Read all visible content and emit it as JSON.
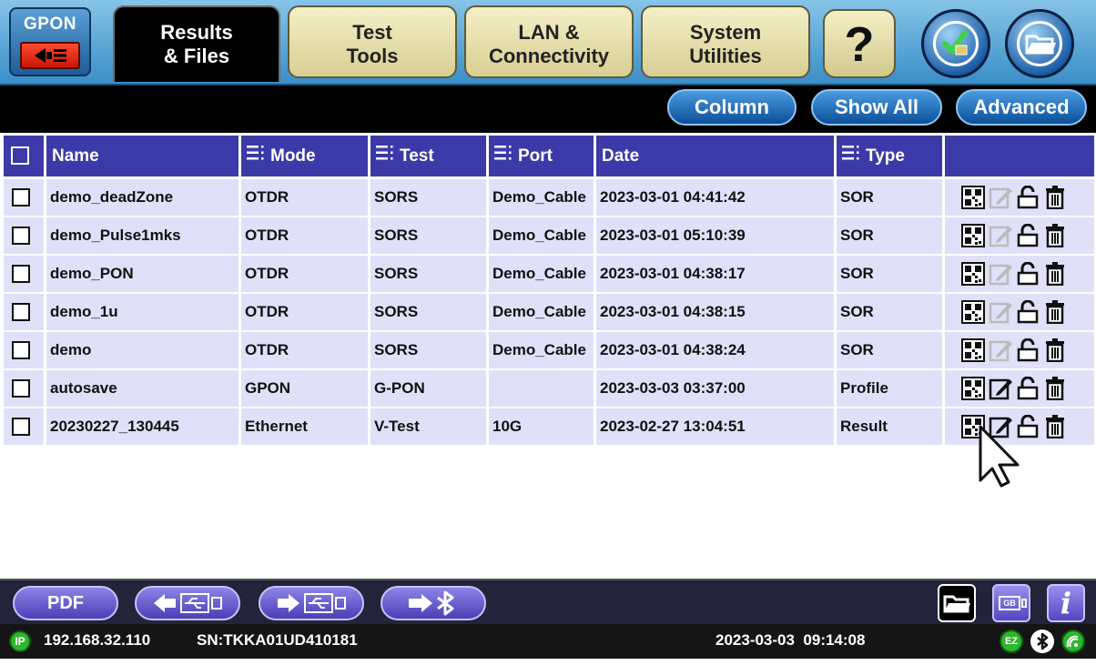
{
  "top_nav": {
    "gpon_label": "GPON",
    "tabs": [
      {
        "line1": "Results",
        "line2": "& Files"
      },
      {
        "line1": "Test",
        "line2": "Tools"
      },
      {
        "line1": "LAN &",
        "line2": "Connectivity"
      },
      {
        "line1": "System",
        "line2": "Utilities"
      }
    ],
    "help_label": "?"
  },
  "toolbar": {
    "column_label": "Column",
    "show_all_label": "Show All",
    "advanced_label": "Advanced"
  },
  "table": {
    "headers": {
      "name": "Name",
      "mode": "Mode",
      "test": "Test",
      "port": "Port",
      "date": "Date",
      "type": "Type"
    },
    "rows": [
      {
        "name": "demo_deadZone",
        "mode": "OTDR",
        "test": "SORS",
        "port": "Demo_Cable",
        "date": "2023-03-01 04:41:42",
        "type": "SOR",
        "editable": false
      },
      {
        "name": "demo_Pulse1mks",
        "mode": "OTDR",
        "test": "SORS",
        "port": "Demo_Cable",
        "date": "2023-03-01 05:10:39",
        "type": "SOR",
        "editable": false
      },
      {
        "name": "demo_PON",
        "mode": "OTDR",
        "test": "SORS",
        "port": "Demo_Cable",
        "date": "2023-03-01 04:38:17",
        "type": "SOR",
        "editable": false
      },
      {
        "name": "demo_1u",
        "mode": "OTDR",
        "test": "SORS",
        "port": "Demo_Cable",
        "date": "2023-03-01 04:38:15",
        "type": "SOR",
        "editable": false
      },
      {
        "name": "demo",
        "mode": "OTDR",
        "test": "SORS",
        "port": "Demo_Cable",
        "date": "2023-03-01 04:38:24",
        "type": "SOR",
        "editable": false
      },
      {
        "name": "autosave",
        "mode": "GPON",
        "test": "G-PON",
        "port": "",
        "date": "2023-03-03 03:37:00",
        "type": "Profile",
        "editable": true
      },
      {
        "name": "20230227_130445",
        "mode": "Ethernet",
        "test": "V-Test",
        "port": "10G",
        "date": "2023-02-27 13:04:51",
        "type": "Result",
        "editable": true
      }
    ]
  },
  "bottom_bar": {
    "pdf_label": "PDF",
    "gb_label": "GB",
    "info_label": "i"
  },
  "status_bar": {
    "ip_badge": "IP",
    "ip": "192.168.32.110",
    "serial": "SN:TKKA01UD410181",
    "datetime": "2023-03-03  09:14:08",
    "ez_label": "EZ"
  },
  "colors": {
    "header_bg": "#3c3aa8",
    "row_bg": "#e0e0f8",
    "toolbar_bg": "#000000",
    "pill_blue": "#0c4f9a",
    "bottom_pill": "#4a3fb5"
  }
}
